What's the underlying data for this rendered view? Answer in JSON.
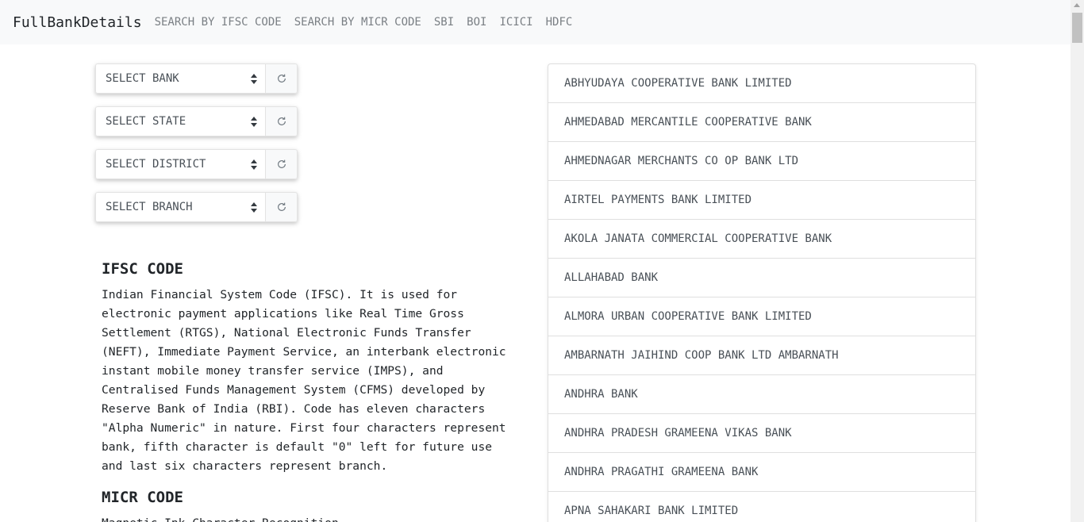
{
  "navbar": {
    "brand": "FullBankDetails",
    "links": [
      "SEARCH BY IFSC CODE",
      "SEARCH BY MICR CODE",
      "SBI",
      "BOI",
      "ICICI",
      "HDFC"
    ]
  },
  "selects": {
    "bank": "SELECT BANK",
    "state": "SELECT STATE",
    "district": "SELECT DISTRICT",
    "branch": "SELECT BRANCH"
  },
  "ifsc": {
    "heading": "IFSC CODE",
    "text": "Indian Financial System Code (IFSC). It is used for electronic payment applications like Real Time Gross Settlement (RTGS), National Electronic Funds Transfer (NEFT), Immediate Payment Service, an interbank electronic instant mobile money transfer service (IMPS), and Centralised Funds Management System (CFMS) developed by Reserve Bank of India (RBI). Code has eleven characters \"Alpha Numeric\" in nature. First four characters represent bank, fifth character is default \"0\" left for future use and last six characters represent branch."
  },
  "micr": {
    "heading": "MICR CODE",
    "text": "Magnetic Ink Character Recognition"
  },
  "banks": [
    "ABHYUDAYA COOPERATIVE BANK LIMITED",
    "AHMEDABAD MERCANTILE COOPERATIVE BANK",
    "AHMEDNAGAR MERCHANTS CO OP BANK LTD",
    "AIRTEL PAYMENTS BANK LIMITED",
    "AKOLA JANATA COMMERCIAL COOPERATIVE BANK",
    "ALLAHABAD BANK",
    "ALMORA URBAN COOPERATIVE BANK LIMITED",
    "AMBARNATH JAIHIND COOP BANK LTD AMBARNATH",
    "ANDHRA BANK",
    "ANDHRA PRADESH GRAMEENA VIKAS BANK",
    "ANDHRA PRAGATHI GRAMEENA BANK",
    "APNA SAHAKARI BANK LIMITED"
  ]
}
